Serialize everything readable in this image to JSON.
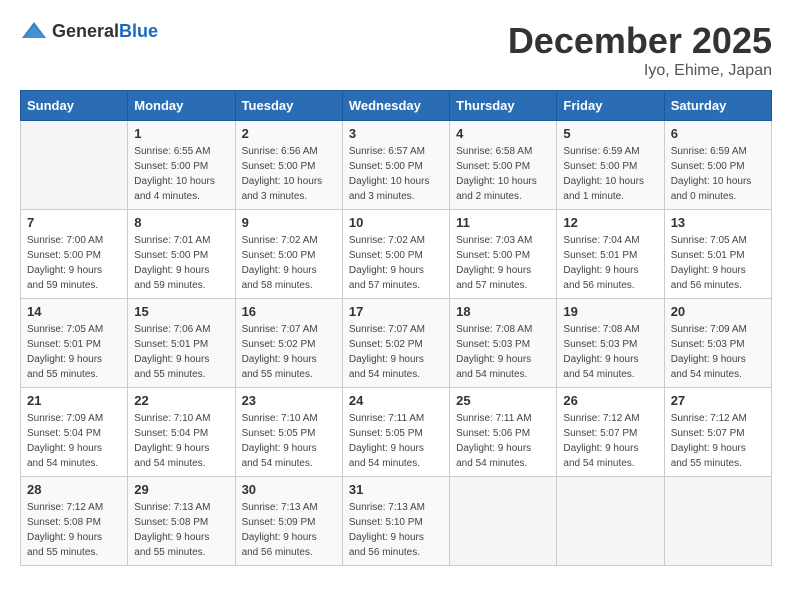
{
  "header": {
    "logo_general": "General",
    "logo_blue": "Blue",
    "title": "December 2025",
    "subtitle": "Iyo, Ehime, Japan"
  },
  "calendar": {
    "days_of_week": [
      "Sunday",
      "Monday",
      "Tuesday",
      "Wednesday",
      "Thursday",
      "Friday",
      "Saturday"
    ],
    "weeks": [
      [
        {
          "day": "",
          "info": ""
        },
        {
          "day": "1",
          "info": "Sunrise: 6:55 AM\nSunset: 5:00 PM\nDaylight: 10 hours\nand 4 minutes."
        },
        {
          "day": "2",
          "info": "Sunrise: 6:56 AM\nSunset: 5:00 PM\nDaylight: 10 hours\nand 3 minutes."
        },
        {
          "day": "3",
          "info": "Sunrise: 6:57 AM\nSunset: 5:00 PM\nDaylight: 10 hours\nand 3 minutes."
        },
        {
          "day": "4",
          "info": "Sunrise: 6:58 AM\nSunset: 5:00 PM\nDaylight: 10 hours\nand 2 minutes."
        },
        {
          "day": "5",
          "info": "Sunrise: 6:59 AM\nSunset: 5:00 PM\nDaylight: 10 hours\nand 1 minute."
        },
        {
          "day": "6",
          "info": "Sunrise: 6:59 AM\nSunset: 5:00 PM\nDaylight: 10 hours\nand 0 minutes."
        }
      ],
      [
        {
          "day": "7",
          "info": "Sunrise: 7:00 AM\nSunset: 5:00 PM\nDaylight: 9 hours\nand 59 minutes."
        },
        {
          "day": "8",
          "info": "Sunrise: 7:01 AM\nSunset: 5:00 PM\nDaylight: 9 hours\nand 59 minutes."
        },
        {
          "day": "9",
          "info": "Sunrise: 7:02 AM\nSunset: 5:00 PM\nDaylight: 9 hours\nand 58 minutes."
        },
        {
          "day": "10",
          "info": "Sunrise: 7:02 AM\nSunset: 5:00 PM\nDaylight: 9 hours\nand 57 minutes."
        },
        {
          "day": "11",
          "info": "Sunrise: 7:03 AM\nSunset: 5:00 PM\nDaylight: 9 hours\nand 57 minutes."
        },
        {
          "day": "12",
          "info": "Sunrise: 7:04 AM\nSunset: 5:01 PM\nDaylight: 9 hours\nand 56 minutes."
        },
        {
          "day": "13",
          "info": "Sunrise: 7:05 AM\nSunset: 5:01 PM\nDaylight: 9 hours\nand 56 minutes."
        }
      ],
      [
        {
          "day": "14",
          "info": "Sunrise: 7:05 AM\nSunset: 5:01 PM\nDaylight: 9 hours\nand 55 minutes."
        },
        {
          "day": "15",
          "info": "Sunrise: 7:06 AM\nSunset: 5:01 PM\nDaylight: 9 hours\nand 55 minutes."
        },
        {
          "day": "16",
          "info": "Sunrise: 7:07 AM\nSunset: 5:02 PM\nDaylight: 9 hours\nand 55 minutes."
        },
        {
          "day": "17",
          "info": "Sunrise: 7:07 AM\nSunset: 5:02 PM\nDaylight: 9 hours\nand 54 minutes."
        },
        {
          "day": "18",
          "info": "Sunrise: 7:08 AM\nSunset: 5:03 PM\nDaylight: 9 hours\nand 54 minutes."
        },
        {
          "day": "19",
          "info": "Sunrise: 7:08 AM\nSunset: 5:03 PM\nDaylight: 9 hours\nand 54 minutes."
        },
        {
          "day": "20",
          "info": "Sunrise: 7:09 AM\nSunset: 5:03 PM\nDaylight: 9 hours\nand 54 minutes."
        }
      ],
      [
        {
          "day": "21",
          "info": "Sunrise: 7:09 AM\nSunset: 5:04 PM\nDaylight: 9 hours\nand 54 minutes."
        },
        {
          "day": "22",
          "info": "Sunrise: 7:10 AM\nSunset: 5:04 PM\nDaylight: 9 hours\nand 54 minutes."
        },
        {
          "day": "23",
          "info": "Sunrise: 7:10 AM\nSunset: 5:05 PM\nDaylight: 9 hours\nand 54 minutes."
        },
        {
          "day": "24",
          "info": "Sunrise: 7:11 AM\nSunset: 5:05 PM\nDaylight: 9 hours\nand 54 minutes."
        },
        {
          "day": "25",
          "info": "Sunrise: 7:11 AM\nSunset: 5:06 PM\nDaylight: 9 hours\nand 54 minutes."
        },
        {
          "day": "26",
          "info": "Sunrise: 7:12 AM\nSunset: 5:07 PM\nDaylight: 9 hours\nand 54 minutes."
        },
        {
          "day": "27",
          "info": "Sunrise: 7:12 AM\nSunset: 5:07 PM\nDaylight: 9 hours\nand 55 minutes."
        }
      ],
      [
        {
          "day": "28",
          "info": "Sunrise: 7:12 AM\nSunset: 5:08 PM\nDaylight: 9 hours\nand 55 minutes."
        },
        {
          "day": "29",
          "info": "Sunrise: 7:13 AM\nSunset: 5:08 PM\nDaylight: 9 hours\nand 55 minutes."
        },
        {
          "day": "30",
          "info": "Sunrise: 7:13 AM\nSunset: 5:09 PM\nDaylight: 9 hours\nand 56 minutes."
        },
        {
          "day": "31",
          "info": "Sunrise: 7:13 AM\nSunset: 5:10 PM\nDaylight: 9 hours\nand 56 minutes."
        },
        {
          "day": "",
          "info": ""
        },
        {
          "day": "",
          "info": ""
        },
        {
          "day": "",
          "info": ""
        }
      ]
    ]
  }
}
